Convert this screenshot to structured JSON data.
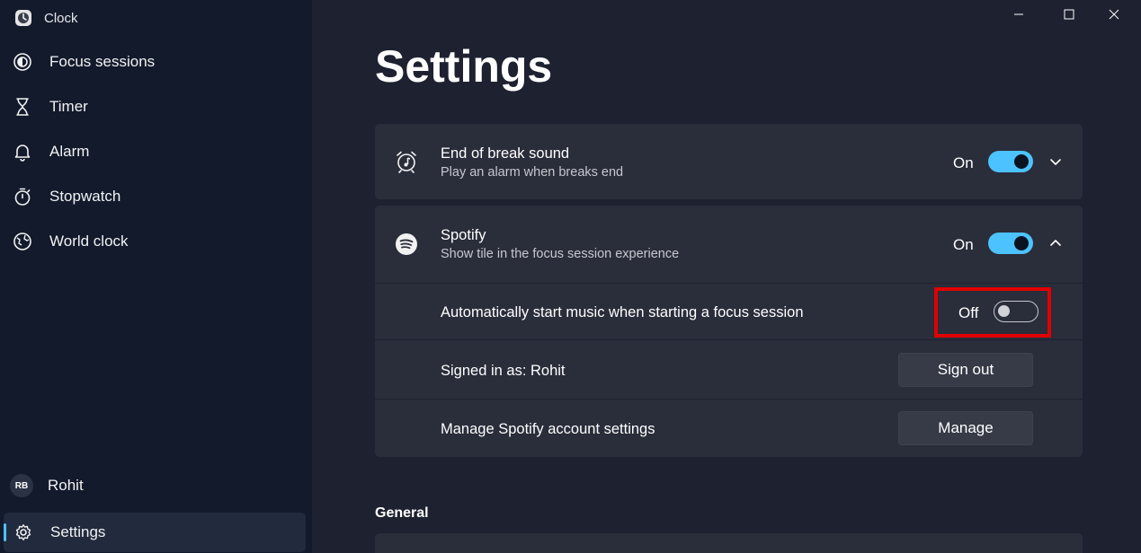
{
  "app": {
    "title": "Clock"
  },
  "sidebar": {
    "items": [
      {
        "label": "Focus sessions",
        "icon": "focus-icon"
      },
      {
        "label": "Timer",
        "icon": "hourglass-icon"
      },
      {
        "label": "Alarm",
        "icon": "bell-icon"
      },
      {
        "label": "Stopwatch",
        "icon": "stopwatch-icon"
      },
      {
        "label": "World clock",
        "icon": "globe-icon"
      }
    ],
    "account": {
      "initials": "RB",
      "name": "Rohit"
    },
    "settings": {
      "label": "Settings",
      "icon": "gear-icon",
      "active": true
    }
  },
  "page": {
    "title": "Settings"
  },
  "settings": {
    "end_break": {
      "title": "End of break sound",
      "subtitle": "Play an alarm when breaks end",
      "state": "On",
      "icon": "alarm-music-icon"
    },
    "spotify": {
      "title": "Spotify",
      "subtitle": "Show tile in the focus session experience",
      "state": "On",
      "icon": "spotify-icon"
    },
    "auto_music": {
      "label": "Automatically start music when starting a focus session",
      "state": "Off"
    },
    "signed_in": {
      "label": "Signed in as: Rohit",
      "button": "Sign out"
    },
    "manage": {
      "label": "Manage Spotify account settings",
      "button": "Manage"
    }
  },
  "section": {
    "general": "General"
  },
  "colors": {
    "accent": "#4cc2ff",
    "highlight": "#e00000",
    "sidebar_bg": "#121a2c",
    "main_bg": "#1e2230",
    "card_bg": "#2a2d3a"
  }
}
